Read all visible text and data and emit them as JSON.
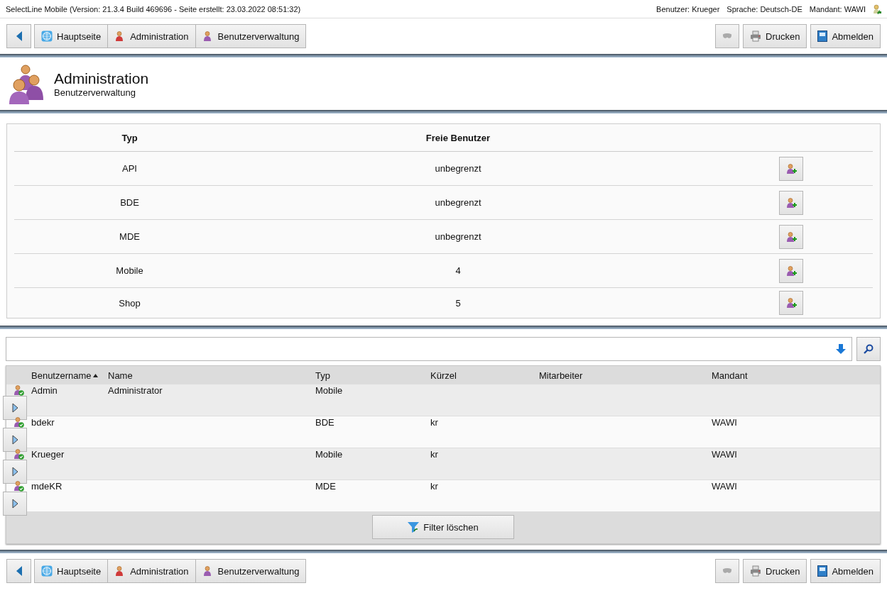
{
  "info_bar": {
    "app_info": "SelectLine Mobile (Version: 21.3.4 Build 469696 - Seite erstellt: 23.03.2022 08:51:32)",
    "user": "Benutzer: Krueger",
    "language": "Sprache: Deutsch-DE",
    "client": "Mandant: WAWI"
  },
  "top_toolbar": {
    "breadcrumbs": [
      {
        "kind": "home",
        "label": "Hauptseite"
      },
      {
        "kind": "admin",
        "label": "Administration"
      },
      {
        "kind": "users",
        "label": "Benutzerverwaltung"
      }
    ],
    "print_label": "Drucken",
    "logout_label": "Abmelden"
  },
  "page_header": {
    "title": "Administration",
    "subtitle": "Benutzerverwaltung"
  },
  "licenses": {
    "columns": [
      "Typ",
      "Freie Benutzer"
    ],
    "rows": [
      {
        "type": "API",
        "free": "unbegrenzt"
      },
      {
        "type": "BDE",
        "free": "unbegrenzt"
      },
      {
        "type": "MDE",
        "free": "unbegrenzt"
      },
      {
        "type": "Mobile",
        "free": "4"
      },
      {
        "type": "Shop",
        "free": "5"
      }
    ]
  },
  "users": {
    "columns": [
      {
        "label": "Benutzername",
        "sorted": true
      },
      {
        "label": "Name",
        "sorted": false
      },
      {
        "label": "Typ",
        "sorted": false
      },
      {
        "label": "Kürzel",
        "sorted": false
      },
      {
        "label": "Mitarbeiter",
        "sorted": false
      },
      {
        "label": "Mandant",
        "sorted": false
      }
    ],
    "rows": [
      {
        "username": "Admin",
        "name": "Administrator",
        "type": "Mobile",
        "short": "",
        "employee": "",
        "client": ""
      },
      {
        "username": "bdekr",
        "name": "",
        "type": "BDE",
        "short": "kr",
        "employee": "",
        "client": "WAWI"
      },
      {
        "username": "Krueger",
        "name": "",
        "type": "Mobile",
        "short": "kr",
        "employee": "",
        "client": "WAWI"
      },
      {
        "username": "mdeKR",
        "name": "",
        "type": "MDE",
        "short": "kr",
        "employee": "",
        "client": "WAWI"
      }
    ],
    "clear_filter_label": "Filter löschen"
  },
  "bottom_toolbar": {
    "breadcrumbs": [
      {
        "kind": "home",
        "label": "Hauptseite"
      },
      {
        "kind": "admin",
        "label": "Administration"
      },
      {
        "kind": "users",
        "label": "Benutzerverwaltung"
      }
    ],
    "print_label": "Drucken",
    "logout_label": "Abmelden"
  }
}
